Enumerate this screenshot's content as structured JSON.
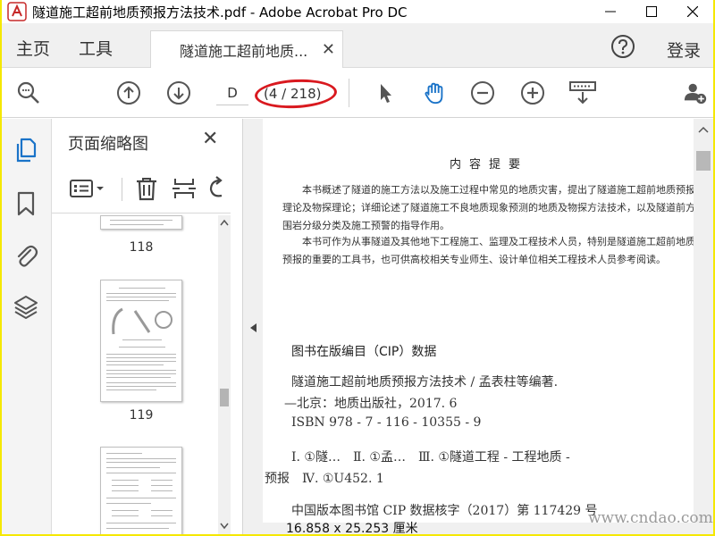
{
  "window": {
    "title": "隧道施工超前地质预报方法技术.pdf - Adobe Acrobat Pro DC",
    "minimize_icon": "minimize-icon",
    "maximize_icon": "maximize-icon",
    "close_icon": "close-icon"
  },
  "menu": {
    "home": "主页",
    "tools": "工具",
    "help_icon": "help-icon",
    "login": "登录"
  },
  "tab": {
    "label": "隧道施工超前地质...",
    "close": "✕"
  },
  "toolbar": {
    "page_input_value": "D",
    "page_count": "(4 / 218)",
    "icons": [
      "zoom-icon",
      "prev-page-icon",
      "next-page-icon",
      "select-arrow-icon",
      "hand-tool-icon",
      "zoom-out-icon",
      "zoom-in-icon",
      "marquee-zoom-icon",
      "share-user-icon"
    ],
    "accent": "#1a73c8",
    "highlight_color": "#d9191f"
  },
  "thumbnail_panel": {
    "title": "页面缩略图",
    "close": "✕",
    "thumbnails": [
      {
        "label": "118"
      },
      {
        "label": "119"
      },
      {
        "label": ""
      }
    ]
  },
  "document": {
    "heading": "内容提要",
    "paragraphs": [
      "本书概述了隧道的施工方法以及施工过程中常见的地质灾害，提出了隧道施工超前地质预报理论及物探理论；详细论述了隧道施工不良地质现象预测的地质及物探方法技术，以及隧道前方围岩分级分类及施工预警的指导作用。",
      "本书可作为从事隧道及其他地下工程施工、监理及工程技术人员，特别是隧道施工超前地质预报的重要的工具书，也可供高校相关专业师生、设计单位相关工程技术人员参考阅读。"
    ],
    "cip_title": "图书在版编目（CIP）数据",
    "cip_lines": [
      "隧道施工超前地质预报方法技术 / 孟表柱等编著.",
      "—北京：地质出版社，2017. 6",
      "ISBN 978 - 7 - 116 - 10355 - 9",
      "Ⅰ. ①隧…　Ⅱ. ①孟…　Ⅲ. ①隧道工程 - 工程地质 -",
      "预报　Ⅳ. ①U452. 1",
      "中国版本图书馆 CIP 数据核字（2017）第 117429 号"
    ]
  },
  "status": {
    "page_size": "16.858 x 25.253 厘米"
  },
  "watermark": {
    "text": "www.cndao.com"
  }
}
